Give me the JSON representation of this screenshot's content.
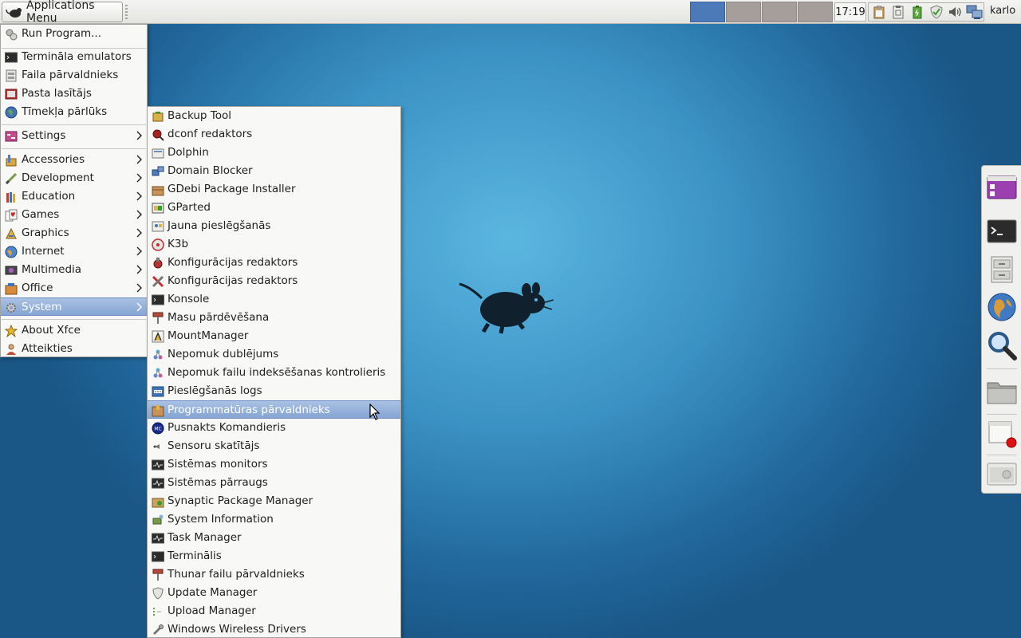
{
  "top_panel": {
    "apps_menu_label": "Applications Menu",
    "clock": "17:19",
    "user": "karlo",
    "workspaces": [
      {
        "active": true
      },
      {
        "active": false
      },
      {
        "active": false
      },
      {
        "active": false
      }
    ]
  },
  "main_menu": {
    "items": [
      {
        "label": "Run Program...",
        "icon": "run-program-icon"
      },
      {
        "label": "Termināla emulators",
        "icon": "terminal-icon"
      },
      {
        "label": "Faila pārvaldnieks",
        "icon": "file-manager-icon"
      },
      {
        "label": "Pasta lasītājs",
        "icon": "mail-reader-icon"
      },
      {
        "label": "Tīmekļa pārlūks",
        "icon": "web-browser-icon"
      },
      {
        "label": "Settings",
        "icon": "settings-icon"
      },
      {
        "label": "Accessories",
        "icon": "accessories-icon"
      },
      {
        "label": "Development",
        "icon": "development-icon"
      },
      {
        "label": "Education",
        "icon": "education-icon"
      },
      {
        "label": "Games",
        "icon": "games-icon"
      },
      {
        "label": "Graphics",
        "icon": "graphics-icon"
      },
      {
        "label": "Internet",
        "icon": "internet-icon"
      },
      {
        "label": "Multimedia",
        "icon": "multimedia-icon"
      },
      {
        "label": "Office",
        "icon": "office-icon"
      },
      {
        "label": "System",
        "icon": "system-icon"
      },
      {
        "label": "About Xfce",
        "icon": "about-star-icon"
      },
      {
        "label": "Atteikties",
        "icon": "logout-icon"
      }
    ]
  },
  "system_submenu": {
    "items": [
      {
        "label": "Backup Tool"
      },
      {
        "label": "dconf redaktors"
      },
      {
        "label": "Dolphin"
      },
      {
        "label": "Domain Blocker"
      },
      {
        "label": "GDebi Package Installer"
      },
      {
        "label": "GParted"
      },
      {
        "label": "Jauna pieslēgšanās"
      },
      {
        "label": "K3b"
      },
      {
        "label": "Konfigurācijas redaktors"
      },
      {
        "label": "Konfigurācijas redaktors"
      },
      {
        "label": "Konsole"
      },
      {
        "label": "Masu pārdēvēšana"
      },
      {
        "label": "MountManager"
      },
      {
        "label": "Nepomuk dublējums"
      },
      {
        "label": "Nepomuk failu indeksēšanas kontrolieris"
      },
      {
        "label": "Pieslēgšanās logs"
      },
      {
        "label": "Programmatūras pārvaldnieks"
      },
      {
        "label": "Pusnakts Komandieris"
      },
      {
        "label": "Sensoru skatītājs"
      },
      {
        "label": "Sistēmas monitors"
      },
      {
        "label": "Sistēmas pārraugs"
      },
      {
        "label": "Synaptic Package Manager"
      },
      {
        "label": "System Information"
      },
      {
        "label": "Task Manager"
      },
      {
        "label": "Terminālis"
      },
      {
        "label": "Thunar failu pārvaldnieks"
      },
      {
        "label": "Update Manager"
      },
      {
        "label": "Upload Manager"
      },
      {
        "label": "Windows Wireless Drivers"
      }
    ]
  },
  "dock": {
    "items": [
      "media-player-icon",
      "terminal-icon",
      "file-cabinet-icon",
      "web-browser-icon",
      "search-icon",
      "folder-icon",
      "screen-recorder-icon",
      "screenshot-icon"
    ]
  },
  "colors": {
    "selection": "#86a5d4",
    "workspace_active": "#4c7ab8",
    "workspace_inactive": "#a59e9b"
  }
}
